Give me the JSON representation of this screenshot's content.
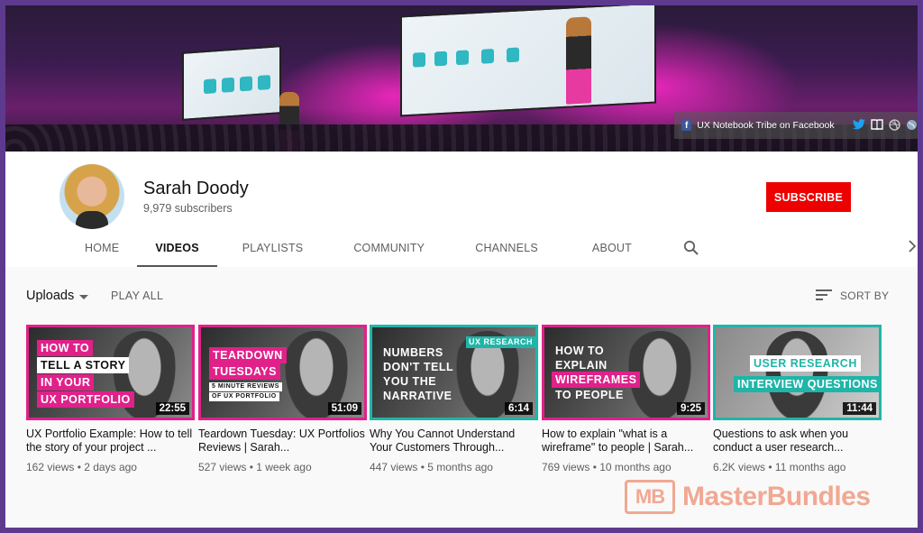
{
  "banner": {
    "facebook_label": "UX Notebook Tribe on Facebook",
    "social_icons": [
      "facebook-icon",
      "twitter-icon",
      "book-icon",
      "dribbble-icon",
      "globe-icon"
    ]
  },
  "channel": {
    "name": "Sarah Doody",
    "subscribers": "9,979 subscribers",
    "subscribe_label": "SUBSCRIBE"
  },
  "tabs": [
    {
      "label": "HOME",
      "active": false
    },
    {
      "label": "VIDEOS",
      "active": true
    },
    {
      "label": "PLAYLISTS",
      "active": false
    },
    {
      "label": "COMMUNITY",
      "active": false
    },
    {
      "label": "CHANNELS",
      "active": false
    },
    {
      "label": "ABOUT",
      "active": false
    }
  ],
  "uploads": {
    "label": "Uploads",
    "play_all": "PLAY ALL",
    "sort_by": "SORT BY"
  },
  "videos": [
    {
      "title": "UX Portfolio Example: How to tell the story of your project ...",
      "views": "162 views",
      "age": "2 days ago",
      "duration": "22:55",
      "thumb_text": [
        "HOW TO",
        "TELL A STORY",
        "IN YOUR",
        "UX PORTFOLIO"
      ]
    },
    {
      "title": "Teardown Tuesday: UX Portfolios Reviews | Sarah...",
      "views": "527 views",
      "age": "1 week ago",
      "duration": "51:09",
      "thumb_text": [
        "TEARDOWN",
        "TUESDAYS",
        "5 MINUTE REVIEWS",
        "OF UX PORTFOLIO"
      ]
    },
    {
      "title": "Why You Cannot Understand Your Customers Through...",
      "views": "447 views",
      "age": "5 months ago",
      "duration": "6:14",
      "thumb_text": [
        "NUMBERS",
        "DON'T TELL",
        "YOU THE",
        "NARRATIVE",
        "UX RESEARCH"
      ]
    },
    {
      "title": "How to explain \"what is a wireframe\" to people | Sarah...",
      "views": "769 views",
      "age": "10 months ago",
      "duration": "9:25",
      "thumb_text": [
        "HOW TO",
        "EXPLAIN",
        "WIREFRAMES",
        "TO PEOPLE"
      ]
    },
    {
      "title": "Questions to ask when you conduct a user research...",
      "views": "6.2K views",
      "age": "11 months ago",
      "duration": "11:44",
      "thumb_text": [
        "USER RESEARCH",
        "INTERVIEW QUESTIONS"
      ]
    }
  ],
  "watermark": {
    "logo": "MB",
    "text": "MasterBundles"
  },
  "colors": {
    "frame": "#5e3a8f",
    "subscribe": "#ee0000",
    "pink": "#e0218a",
    "teal": "#1fb5a8",
    "watermark": "#f1a892"
  }
}
